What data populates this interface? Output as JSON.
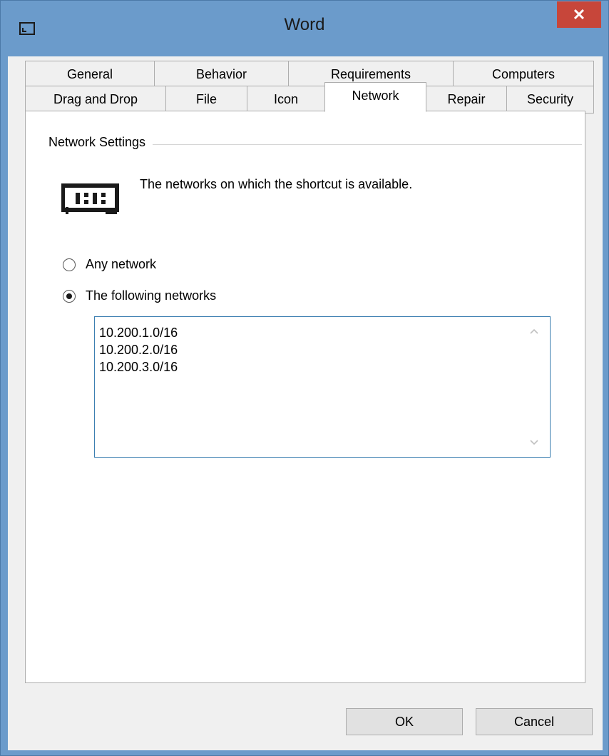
{
  "window": {
    "title": "Word",
    "close_glyph": "✕"
  },
  "tabs_row1": [
    "General",
    "Behavior",
    "Requirements",
    "Computers"
  ],
  "tabs_row2": [
    "Drag and Drop",
    "File",
    "Icon",
    "Network",
    "Repair",
    "Security"
  ],
  "active_tab": "Network",
  "group": {
    "label": "Network Settings",
    "description": "The networks on which the shortcut is available.",
    "icon": "network-card-icon"
  },
  "options": [
    {
      "label": "Any network",
      "checked": false
    },
    {
      "label": "The following networks",
      "checked": true
    }
  ],
  "networks": [
    "10.200.1.0/16",
    "10.200.2.0/16",
    "10.200.3.0/16"
  ],
  "buttons": {
    "ok": "OK",
    "cancel": "Cancel"
  }
}
